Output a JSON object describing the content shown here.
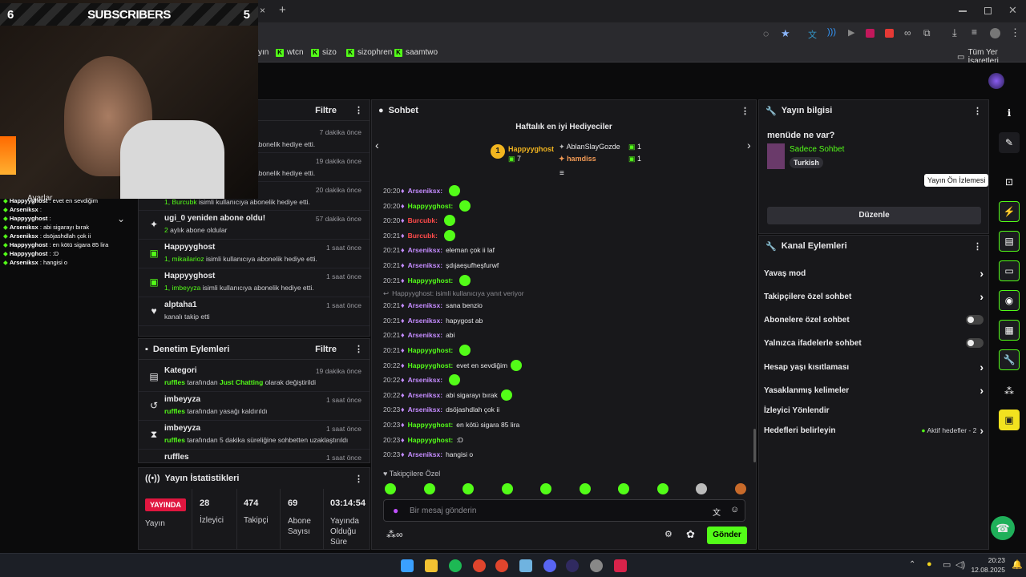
{
  "browser": {
    "new_tab": "+",
    "tab_close": "×",
    "bookmarks": [
      "yın",
      "wtcn",
      "sizo",
      "sizophren",
      "saamtwo"
    ],
    "all_bookmarks": "Tüm Yer İşaretleri"
  },
  "overlay": {
    "sub_left": "6",
    "sub_label": "SUBSCRIBERS",
    "sub_right": "5",
    "ayarlar": "Ayarlar",
    "mini_chat": [
      {
        "user": "Happyyghost",
        "text": "evet en sevdiğim"
      },
      {
        "user": "Arseniksx",
        "text": ""
      },
      {
        "user": "Happyyghost",
        "text": ""
      },
      {
        "user": "Arseniksx",
        "text": "abi sigarayı bırak"
      },
      {
        "user": "Arseniksx",
        "text": "dsöjashdlah çok ii"
      },
      {
        "user": "Happyyghost",
        "text": "en kötü sigara 85 lira"
      },
      {
        "user": "Happyyghost",
        "text": ":D"
      },
      {
        "user": "Arseniksx",
        "text": "hangisi o"
      }
    ]
  },
  "activity": {
    "filter": "Filtre",
    "rows": [
      {
        "title": "",
        "sub": "abonelik hediye etti.",
        "time": "7 dakika önce"
      },
      {
        "title": "",
        "sub": "abonelik hediye etti.",
        "time": "19 dakika önce"
      },
      {
        "title": "",
        "sub_user": "1, Burcubk",
        "sub": "isimli kullanıcıya abonelik hediye etti.",
        "time": "20 dakika önce"
      },
      {
        "title": "ugi_0 yeniden abone oldu!",
        "sub_user": "2",
        "sub": "aylık abone oldular",
        "time": "57 dakika önce"
      },
      {
        "title": "Happyyghost",
        "sub_user": "1, mikailarioz",
        "sub": "isimli kullanıcıya abonelik hediye etti.",
        "time": "1 saat önce"
      },
      {
        "title": "Happyyghost",
        "sub_user": "1, imbeyyza",
        "sub": "isimli kullanıcıya abonelik hediye etti.",
        "time": "1 saat önce"
      },
      {
        "title": "alptaha1",
        "sub": "kanalı takip etti",
        "time": "1 saat önce"
      }
    ]
  },
  "moderation": {
    "title": "Denetim Eylemleri",
    "filter": "Filtre",
    "rows": [
      {
        "title": "Kategori",
        "user": "ruffles",
        "mid": "tarafından",
        "hl": "Just Chatting",
        "end": "olarak değiştirildi",
        "time": "19 dakika önce"
      },
      {
        "title": "imbeyyza",
        "user": "ruffles",
        "mid": "tarafından yasağı kaldırıldı",
        "time": "1 saat önce"
      },
      {
        "title": "imbeyyza",
        "user": "ruffles",
        "mid": "tarafından 5 dakika süreliğine sohbetten uzaklaştırıldı",
        "time": "1 saat önce"
      },
      {
        "title": "ruffles",
        "time": "1 saat önce"
      }
    ]
  },
  "stats": {
    "title": "Yayın İstatistikleri",
    "live_badge": "YAYINDA",
    "live_label": "Yayın",
    "viewers": "28",
    "viewers_label": "İzleyici",
    "followers": "474",
    "followers_label": "Takipçi",
    "subs": "69",
    "subs_label": "Abone Sayısı",
    "uptime": "03:14:54",
    "uptime_label": "Yayında Olduğu Süre"
  },
  "chat": {
    "title": "Sohbet",
    "gifters_title": "Haftalık en iyi Hediyeciler",
    "top_gifter": "Happyyghost",
    "top_count": "7",
    "top_rank": "1",
    "gifter2": "AblanSlayGozde",
    "gifter2_count": "1",
    "gifter3": "hamdiss",
    "gifter3_count": "1",
    "reply_note": "Happyyghost: isimli kullanıcıya yanıt veriyor",
    "messages": [
      {
        "time": "20:20",
        "user": "Arseniksx:",
        "text": "",
        "color": "purple",
        "emote": true
      },
      {
        "time": "20:20",
        "user": "Happyyghost:",
        "text": "",
        "color": "green",
        "emote": true
      },
      {
        "time": "20:20",
        "user": "Burcubk:",
        "text": "",
        "color": "red",
        "emote": true
      },
      {
        "time": "20:21",
        "user": "Burcubk:",
        "text": "",
        "color": "red",
        "emote": true
      },
      {
        "time": "20:21",
        "user": "Arseniksx:",
        "text": "eleman çok ii laf",
        "color": "purple"
      },
      {
        "time": "20:21",
        "user": "Arseniksx:",
        "text": "şdıjaeşufheşfurwf",
        "color": "purple"
      },
      {
        "time": "20:21",
        "user": "Happyyghost:",
        "text": "",
        "color": "green",
        "emote": true
      },
      {
        "time": "20:21",
        "user": "Arseniksx:",
        "text": "sana benzio",
        "color": "purple"
      },
      {
        "time": "20:21",
        "user": "Arseniksx:",
        "text": "hapygost ab",
        "color": "purple"
      },
      {
        "time": "20:21",
        "user": "Arseniksx:",
        "text": "abi",
        "color": "purple"
      },
      {
        "time": "20:21",
        "user": "Happyyghost:",
        "text": "",
        "color": "green",
        "emote": true
      },
      {
        "time": "20:22",
        "user": "Happyyghost:",
        "text": "evet en sevdiğim",
        "color": "green",
        "emote": true
      },
      {
        "time": "20:22",
        "user": "Arseniksx:",
        "text": "",
        "color": "purple",
        "emote": true
      },
      {
        "time": "20:22",
        "user": "Arseniksx:",
        "text": "abi sigarayı bırak",
        "color": "purple",
        "emote": true
      },
      {
        "time": "20:23",
        "user": "Arseniksx:",
        "text": "dsöjashdlah çok ii",
        "color": "purple"
      },
      {
        "time": "20:23",
        "user": "Happyyghost:",
        "text": "en kötü sigara 85 lira",
        "color": "green"
      },
      {
        "time": "20:23",
        "user": "Happyyghost:",
        "text": ":D",
        "color": "green"
      },
      {
        "time": "20:23",
        "user": "Arseniksx:",
        "text": "hangisi o",
        "color": "purple"
      }
    ],
    "followers_only": "Takipçilere Özel",
    "input_placeholder": "Bir mesaj gönderin",
    "send": "Gönder"
  },
  "stream_info": {
    "title": "Yayın bilgisi",
    "menu_q": "menüde ne var?",
    "category": "Sadece Sohbet",
    "tag": "Turkish",
    "edit": "Düzenle"
  },
  "channel_actions": {
    "title": "Kanal Eylemleri",
    "items": [
      {
        "label": "Yavaş mod",
        "kind": "chev"
      },
      {
        "label": "Takipçilere özel sohbet",
        "kind": "chev"
      },
      {
        "label": "Abonelere özel sohbet",
        "kind": "toggle"
      },
      {
        "label": "Yalnızca ifadelerle sohbet",
        "kind": "toggle"
      },
      {
        "label": "Hesap yaşı kısıtlaması",
        "kind": "chev"
      },
      {
        "label": "Yasaklanmış kelimeler",
        "kind": "chev"
      },
      {
        "label": "İzleyici Yönlendir",
        "kind": "none"
      },
      {
        "label": "Hedefleri belirleyin",
        "kind": "chev",
        "note": "Aktif hedefler - 2"
      }
    ]
  },
  "tooltip": "Yayın Ön İzlemesi",
  "taskbar": {
    "time": "20:23",
    "date": "12.08.2025"
  }
}
